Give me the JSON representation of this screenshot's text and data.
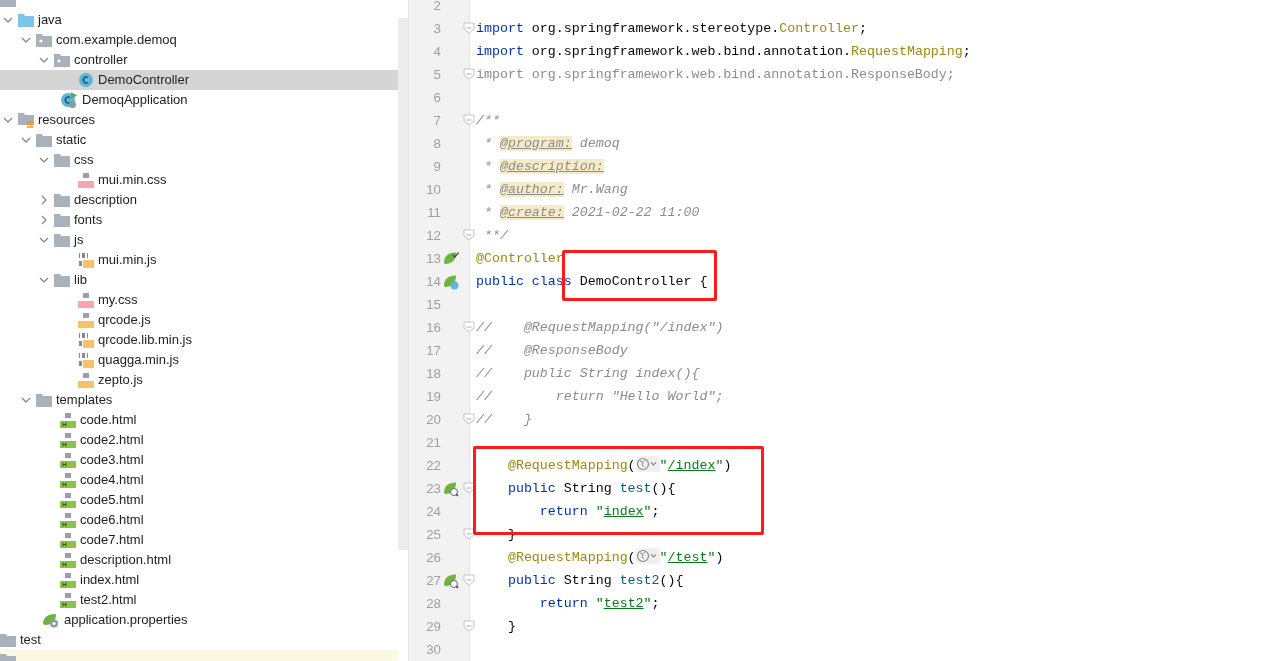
{
  "tree": [
    {
      "kind": "folder",
      "children": [
        {
          "label": "java",
          "kind": "source-folder",
          "expanded": true,
          "children": [
            {
              "label": "com.example.demoq",
              "kind": "package",
              "expanded": true,
              "children": [
                {
                  "label": "controller",
                  "kind": "package",
                  "expanded": true,
                  "children": [
                    {
                      "label": "DemoController",
                      "kind": "class",
                      "selected": true
                    }
                  ]
                },
                {
                  "label": "DemoqApplication",
                  "kind": "app-class",
                  "selected": false
                }
              ]
            }
          ]
        },
        {
          "label": "resources",
          "kind": "resources-folder",
          "expanded": true,
          "children": [
            {
              "label": "static",
              "kind": "folder",
              "expanded": true,
              "children": [
                {
                  "label": "css",
                  "kind": "folder",
                  "expanded": true,
                  "children": [
                    {
                      "label": "mui.min.css",
                      "kind": "css",
                      "selected": false
                    }
                  ]
                },
                {
                  "label": "description",
                  "kind": "folder",
                  "expanded": false
                },
                {
                  "label": "fonts",
                  "kind": "folder",
                  "expanded": false
                },
                {
                  "label": "js",
                  "kind": "folder",
                  "expanded": true,
                  "children": [
                    {
                      "label": "mui.min.js",
                      "kind": "min-js",
                      "selected": false
                    }
                  ]
                },
                {
                  "label": "lib",
                  "kind": "folder",
                  "expanded": true,
                  "children": [
                    {
                      "label": "my.css",
                      "kind": "css",
                      "selected": false
                    },
                    {
                      "label": "qrcode.js",
                      "kind": "js",
                      "selected": false
                    },
                    {
                      "label": "qrcode.lib.min.js",
                      "kind": "min-js",
                      "selected": false
                    },
                    {
                      "label": "quagga.min.js",
                      "kind": "min-js",
                      "selected": false
                    },
                    {
                      "label": "zepto.js",
                      "kind": "js",
                      "selected": false
                    }
                  ]
                }
              ]
            },
            {
              "label": "templates",
              "kind": "folder",
              "expanded": true,
              "children": [
                {
                  "label": "code.html",
                  "kind": "html",
                  "selected": false
                },
                {
                  "label": "code2.html",
                  "kind": "html",
                  "selected": false
                },
                {
                  "label": "code3.html",
                  "kind": "html",
                  "selected": false
                },
                {
                  "label": "code4.html",
                  "kind": "html",
                  "selected": false
                },
                {
                  "label": "code5.html",
                  "kind": "html",
                  "selected": false
                },
                {
                  "label": "code6.html",
                  "kind": "html",
                  "selected": false
                },
                {
                  "label": "code7.html",
                  "kind": "html",
                  "selected": false
                },
                {
                  "label": "description.html",
                  "kind": "html",
                  "selected": false
                },
                {
                  "label": "index.html",
                  "kind": "html",
                  "selected": false
                },
                {
                  "label": "test2.html",
                  "kind": "html",
                  "selected": false
                }
              ]
            },
            {
              "label": "application.properties",
              "kind": "properties",
              "selected": false
            }
          ]
        }
      ]
    },
    {
      "label": "test",
      "kind": "folder"
    },
    {
      "kind": "excluded-folder"
    }
  ],
  "editor": {
    "lines": [
      {
        "number": "2"
      },
      {
        "number": "3",
        "fold": true,
        "tokens": [
          {
            "kind": "keyword",
            "text": "import"
          },
          {
            "kind": "plain",
            "text": " org.springframework.stereotype."
          },
          {
            "kind": "class-ref",
            "text": "Controller"
          },
          {
            "kind": "plain",
            "text": ";"
          }
        ]
      },
      {
        "number": "4",
        "tokens": [
          {
            "kind": "keyword",
            "text": "import"
          },
          {
            "kind": "plain",
            "text": " org.springframework.web.bind.annotation."
          },
          {
            "kind": "class-ref",
            "text": "RequestMapping"
          },
          {
            "kind": "plain",
            "text": ";"
          }
        ]
      },
      {
        "number": "5",
        "fold": true,
        "tokens": [
          {
            "kind": "unused",
            "text": "import org.springframework.web.bind.annotation.ResponseBody;"
          }
        ]
      },
      {
        "number": "6"
      },
      {
        "number": "7",
        "fold": true,
        "tokens": [
          {
            "kind": "comment",
            "text": "/**"
          }
        ]
      },
      {
        "number": "8",
        "tokens": [
          {
            "kind": "comment",
            "text": " * "
          },
          {
            "kind": "doc-tag",
            "text": "@program:"
          },
          {
            "kind": "comment",
            "text": " demoq"
          }
        ]
      },
      {
        "number": "9",
        "tokens": [
          {
            "kind": "comment",
            "text": " * "
          },
          {
            "kind": "doc-tag",
            "text": "@description:"
          }
        ]
      },
      {
        "number": "10",
        "tokens": [
          {
            "kind": "comment",
            "text": " * "
          },
          {
            "kind": "doc-tag",
            "text": "@author:"
          },
          {
            "kind": "comment",
            "text": " Mr.Wang"
          }
        ]
      },
      {
        "number": "11",
        "tokens": [
          {
            "kind": "comment",
            "text": " * "
          },
          {
            "kind": "doc-tag",
            "text": "@create:"
          },
          {
            "kind": "comment",
            "text": " 2021-02-22 11:00"
          }
        ]
      },
      {
        "number": "12",
        "fold": true,
        "tokens": [
          {
            "kind": "comment",
            "text": " **/"
          }
        ]
      },
      {
        "number": "13",
        "gutter": {
          "kind": "bean-check"
        },
        "tokens": [
          {
            "kind": "annotation",
            "text": "@Controller"
          }
        ]
      },
      {
        "number": "14",
        "gutter": {
          "kind": "bean-class"
        },
        "tokens": [
          {
            "kind": "keyword",
            "text": "public class "
          },
          {
            "kind": "plain",
            "text": "DemoController {",
            "boxed": true
          }
        ]
      },
      {
        "number": "15"
      },
      {
        "number": "16",
        "fold": true,
        "tokens": [
          {
            "kind": "comment",
            "text": "//    @RequestMapping(\"/index\")"
          }
        ]
      },
      {
        "number": "17",
        "tokens": [
          {
            "kind": "comment",
            "text": "//    @ResponseBody"
          }
        ]
      },
      {
        "number": "18",
        "tokens": [
          {
            "kind": "comment",
            "text": "//    public String index(){"
          }
        ]
      },
      {
        "number": "19",
        "tokens": [
          {
            "kind": "comment",
            "text": "//        return \"Hello World\";"
          }
        ]
      },
      {
        "number": "20",
        "fold": true,
        "tokens": [
          {
            "kind": "comment",
            "text": "//    }"
          }
        ]
      },
      {
        "number": "21"
      },
      {
        "number": "22",
        "boxed": true,
        "tokens": [
          {
            "kind": "annotation",
            "text": "    @RequestMapping"
          },
          {
            "kind": "plain",
            "text": "("
          },
          {
            "kind": "globe"
          },
          {
            "kind": "string",
            "text": "\""
          },
          {
            "kind": "link-string",
            "text": "/index"
          },
          {
            "kind": "string",
            "text": "\""
          },
          {
            "kind": "plain",
            "text": ")"
          }
        ]
      },
      {
        "number": "23",
        "boxed": true,
        "gutter": {
          "kind": "bean-mapping"
        },
        "fold": true,
        "tokens": [
          {
            "kind": "keyword",
            "text": "    public"
          },
          {
            "kind": "plain",
            "text": " String "
          },
          {
            "kind": "method",
            "text": "test"
          },
          {
            "kind": "plain",
            "text": "(){"
          }
        ]
      },
      {
        "number": "24",
        "boxed": true,
        "tokens": [
          {
            "kind": "keyword",
            "text": "        return "
          },
          {
            "kind": "string",
            "text": "\""
          },
          {
            "kind": "link-string",
            "text": "index"
          },
          {
            "kind": "string",
            "text": "\""
          },
          {
            "kind": "plain",
            "text": ";"
          }
        ]
      },
      {
        "number": "25",
        "fold": true,
        "tokens": [
          {
            "kind": "plain",
            "text": "    }"
          }
        ]
      },
      {
        "number": "26",
        "tokens": [
          {
            "kind": "annotation",
            "text": "    @RequestMapping"
          },
          {
            "kind": "plain",
            "text": "("
          },
          {
            "kind": "globe"
          },
          {
            "kind": "string",
            "text": "\""
          },
          {
            "kind": "link-string",
            "text": "/test"
          },
          {
            "kind": "string",
            "text": "\""
          },
          {
            "kind": "plain",
            "text": ")"
          }
        ]
      },
      {
        "number": "27",
        "gutter": {
          "kind": "bean-mapping"
        },
        "fold": true,
        "tokens": [
          {
            "kind": "keyword",
            "text": "    public"
          },
          {
            "kind": "plain",
            "text": " String "
          },
          {
            "kind": "method",
            "text": "test2"
          },
          {
            "kind": "plain",
            "text": "(){"
          }
        ]
      },
      {
        "number": "28",
        "tokens": [
          {
            "kind": "keyword",
            "text": "        return "
          },
          {
            "kind": "string",
            "text": "\""
          },
          {
            "kind": "link-string",
            "text": "test2"
          },
          {
            "kind": "string",
            "text": "\""
          },
          {
            "kind": "plain",
            "text": ";"
          }
        ]
      },
      {
        "number": "29",
        "fold": true,
        "tokens": [
          {
            "kind": "plain",
            "text": "    }"
          }
        ]
      },
      {
        "number": "30"
      }
    ]
  }
}
